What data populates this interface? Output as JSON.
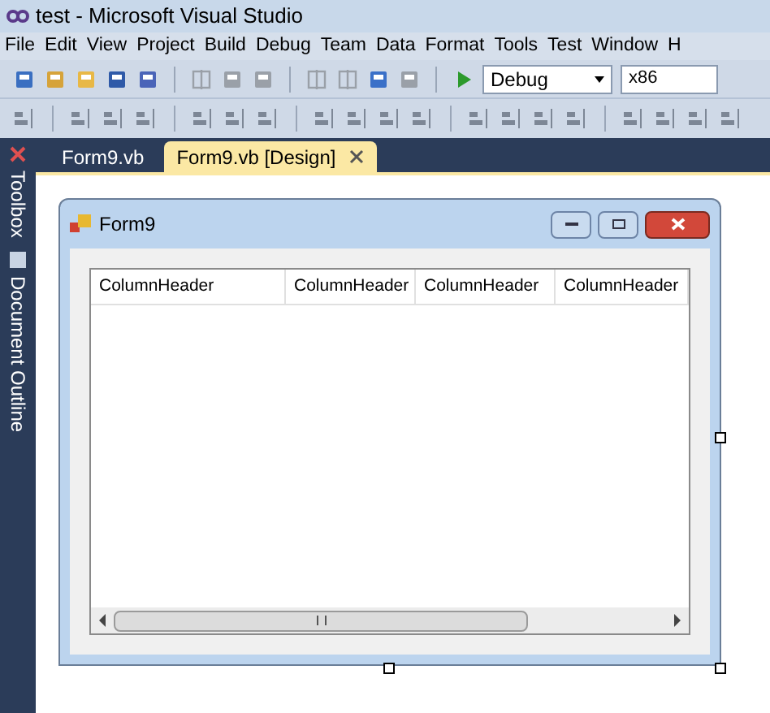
{
  "window": {
    "title": "test - Microsoft Visual Studio"
  },
  "menu": [
    "File",
    "Edit",
    "View",
    "Project",
    "Build",
    "Debug",
    "Team",
    "Data",
    "Format",
    "Tools",
    "Test",
    "Window",
    "H"
  ],
  "toolbar": {
    "configuration": "Debug",
    "platform": "x86"
  },
  "side_tabs": [
    "Toolbox",
    "Document Outline"
  ],
  "tabs": [
    {
      "label": "Form9.vb",
      "selected": false
    },
    {
      "label": "Form9.vb [Design]",
      "selected": true
    }
  ],
  "form": {
    "title": "Form9",
    "columns": [
      "ColumnHeader",
      "ColumnHeader",
      "ColumnHeader",
      "ColumnHeader"
    ]
  }
}
